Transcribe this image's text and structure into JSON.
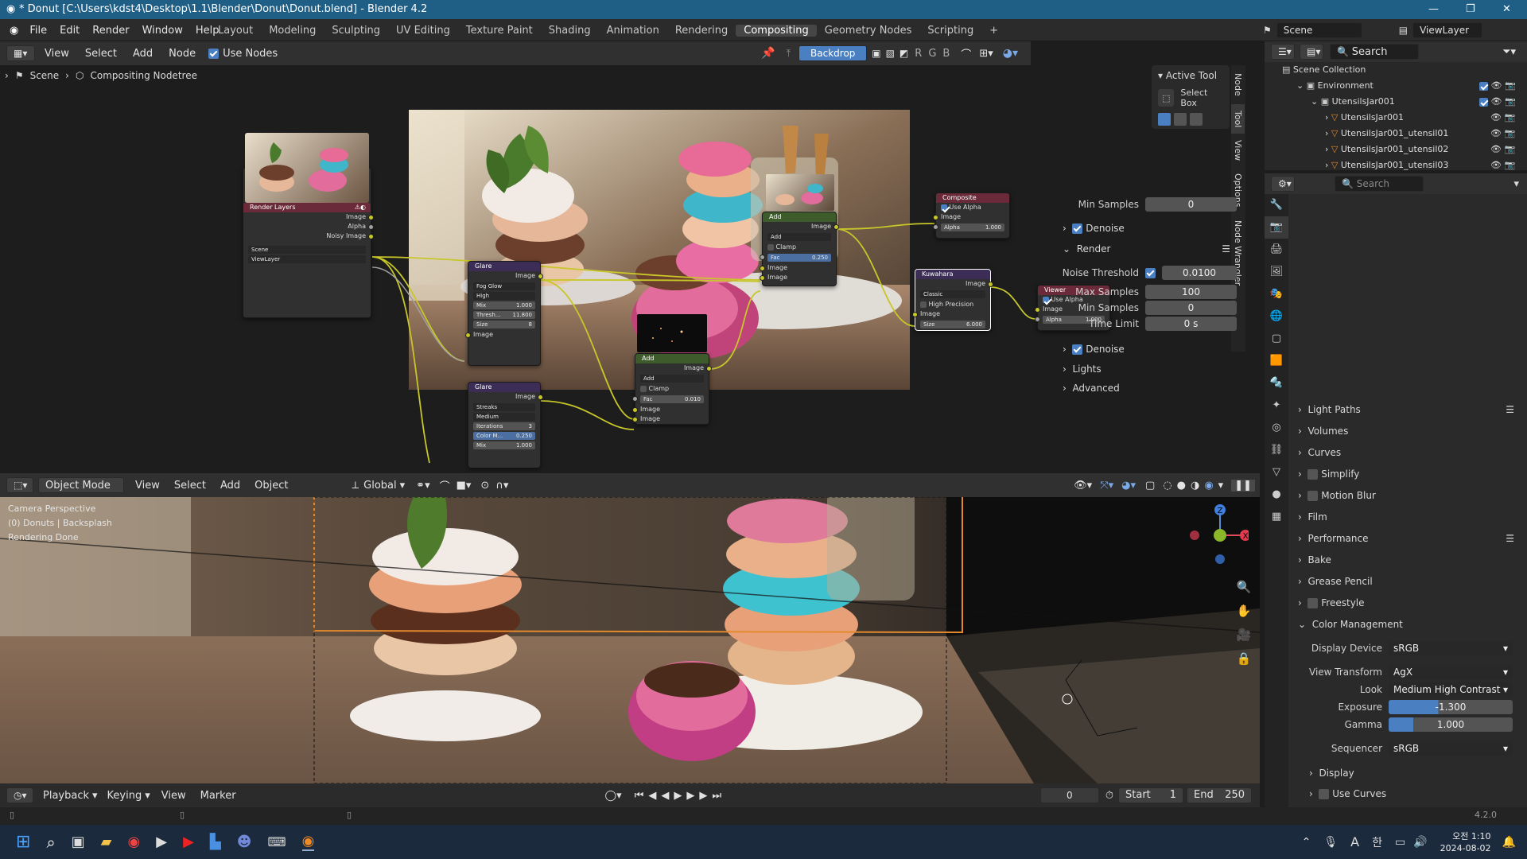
{
  "titlebar": {
    "title": "* Donut [C:\\Users\\kdst4\\Desktop\\1.1\\Blender\\Donut\\Donut.blend] - Blender 4.2"
  },
  "menu": [
    "File",
    "Edit",
    "Render",
    "Window",
    "Help"
  ],
  "workspaces": [
    "Layout",
    "Modeling",
    "Sculpting",
    "UV Editing",
    "Texture Paint",
    "Shading",
    "Animation",
    "Rendering",
    "Compositing",
    "Geometry Nodes",
    "Scripting"
  ],
  "active_workspace": "Compositing",
  "top_right": {
    "scene": "Scene",
    "viewlayer": "ViewLayer"
  },
  "node_editor": {
    "menu": [
      "View",
      "Select",
      "Add",
      "Node"
    ],
    "use_nodes": "Use Nodes",
    "backdrop": "Backdrop",
    "channels": [
      "R",
      "G",
      "B"
    ],
    "breadcrumb": [
      "Scene",
      "Compositing Nodetree"
    ],
    "side_tabs": [
      "Node",
      "Tool",
      "View",
      "Options",
      "Node Wrangler"
    ],
    "active_tool": {
      "title": "Active Tool",
      "tool": "Select Box"
    }
  },
  "nodes": {
    "render_layers": {
      "title": "Render Layers",
      "outputs": [
        "Image",
        "Alpha",
        "Noisy Image"
      ],
      "scene": "Scene",
      "layer": "ViewLayer"
    },
    "glare1": {
      "title": "Glare",
      "out": "Image",
      "type": "Fog Glow",
      "quality": "High",
      "mix": "Mix",
      "mix_v": "1.000",
      "thresh": "Thresh...",
      "thresh_v": "11.800",
      "size": "Size",
      "size_v": "8",
      "in": "Image"
    },
    "glare2": {
      "title": "Glare",
      "out": "Image",
      "type": "Streaks",
      "quality": "Medium",
      "iter": "Iterations",
      "iter_v": "3",
      "color": "Color M...",
      "color_v": "0.250",
      "mix": "Mix",
      "mix_v": "1.000"
    },
    "add1": {
      "title": "Add",
      "out": "Image",
      "op": "Add",
      "clamp": "Clamp",
      "fac": "Fac",
      "fac_v": "0.250",
      "in1": "Image",
      "in2": "Image"
    },
    "add2": {
      "title": "Add",
      "out": "Image",
      "op": "Add",
      "clamp": "Clamp",
      "fac": "Fac",
      "fac_v": "0.010",
      "in1": "Image",
      "in2": "Image"
    },
    "composite": {
      "title": "Composite",
      "use_alpha": "Use Alpha",
      "in": "Image",
      "alpha": "Alpha",
      "alpha_v": "1.000"
    },
    "kuwahara": {
      "title": "Kuwahara",
      "out": "Image",
      "mode": "Classic",
      "hp": "High Precision",
      "in": "Image",
      "size": "Size",
      "size_v": "6.000"
    },
    "viewer": {
      "title": "Viewer",
      "use_alpha": "Use Alpha",
      "in": "Image",
      "alpha": "Alpha",
      "alpha_v": "1.000"
    }
  },
  "viewport": {
    "mode": "Object Mode",
    "menu": [
      "View",
      "Select",
      "Add",
      "Object"
    ],
    "orientation": "Global",
    "overlay_text": [
      "Camera Perspective",
      "(0) Donuts | Backsplash",
      "Rendering Done"
    ]
  },
  "timeline": {
    "menu": [
      "Playback",
      "Keying",
      "View",
      "Marker"
    ],
    "frame": "0",
    "start_label": "Start",
    "start": "1",
    "end_label": "End",
    "end": "250"
  },
  "outliner": {
    "search": "Search",
    "rows": [
      {
        "label": "Scene Collection",
        "indent": 0
      },
      {
        "label": "Environment",
        "indent": 1
      },
      {
        "label": "UtensilsJar001",
        "indent": 2
      },
      {
        "label": "UtensilsJar001",
        "indent": 3
      },
      {
        "label": "UtensilsJar001_utensil01",
        "indent": 3
      },
      {
        "label": "UtensilsJar001_utensil02",
        "indent": 3
      },
      {
        "label": "UtensilsJar001_utensil03",
        "indent": 3
      }
    ]
  },
  "properties": {
    "search": "Search",
    "min_samples_top": {
      "label": "Min Samples",
      "value": "0"
    },
    "denoise1": "Denoise",
    "render": "Render",
    "noise_threshold": {
      "label": "Noise Threshold",
      "value": "0.0100"
    },
    "max_samples": {
      "label": "Max Samples",
      "value": "100"
    },
    "min_samples": {
      "label": "Min Samples",
      "value": "0"
    },
    "time_limit": {
      "label": "Time Limit",
      "value": "0 s"
    },
    "denoise2": "Denoise",
    "lights": "Lights",
    "advanced": "Advanced",
    "sections": [
      "Light Paths",
      "Volumes",
      "Curves",
      "Simplify",
      "Motion Blur",
      "Film",
      "Performance",
      "Bake",
      "Grease Pencil",
      "Freestyle"
    ],
    "color_management": "Color Management",
    "display_device": {
      "label": "Display Device",
      "value": "sRGB"
    },
    "view_transform": {
      "label": "View Transform",
      "value": "AgX"
    },
    "look": {
      "label": "Look",
      "value": "Medium High Contrast"
    },
    "exposure": {
      "label": "Exposure",
      "value": "-1.300"
    },
    "gamma": {
      "label": "Gamma",
      "value": "1.000"
    },
    "sequencer": {
      "label": "Sequencer",
      "value": "sRGB"
    },
    "display": "Display",
    "use_curves": "Use Curves"
  },
  "statusbar": {
    "version": "4.2.0"
  },
  "taskbar": {
    "time": "오전 1:10",
    "date": "2024-08-02",
    "ime": "A",
    "ime2": "한"
  },
  "colors": {
    "accent": "#4a7fc1",
    "titlebar": "#1f5f86",
    "socket_yellow": "#c7c729",
    "header_green": "#3e5b2b",
    "header_purple": "#3b2d55",
    "header_red": "#6b2a3a"
  }
}
